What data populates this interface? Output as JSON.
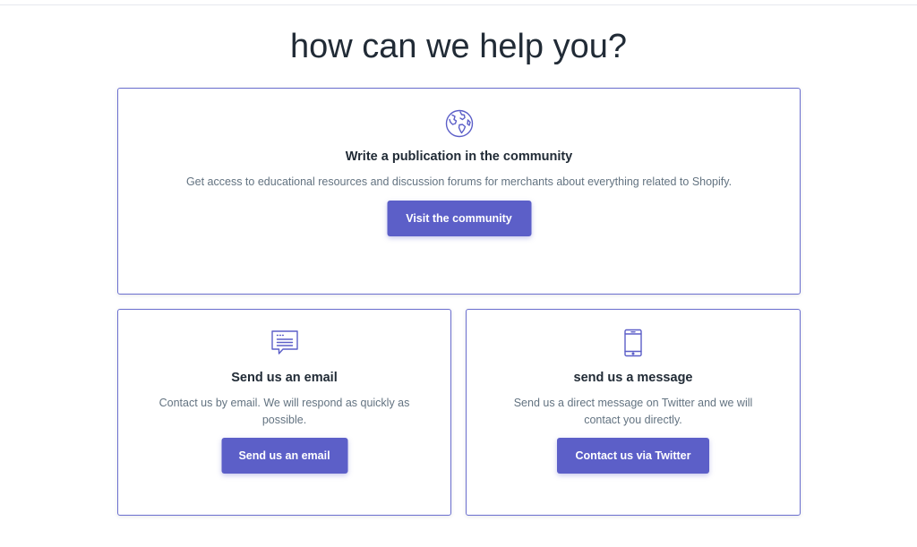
{
  "page": {
    "title": "how can we help you?"
  },
  "theme": {
    "accent": "#5c5fc8",
    "border": "#6b6fcf",
    "text_primary": "#212b36",
    "text_secondary": "#637381"
  },
  "cards": [
    {
      "icon": "globe-icon",
      "title": "Write a publication in the community",
      "description": "Get access to educational resources and discussion forums for merchants about everything related to Shopify.",
      "button_label": "Visit the community"
    },
    {
      "icon": "chat-bubble-icon",
      "title": "Send us an email",
      "description": "Contact us by email. We will respond as quickly as possible.",
      "button_label": "Send us an email"
    },
    {
      "icon": "mobile-phone-icon",
      "title": "send us a message",
      "description": "Send us a direct message on Twitter and we will contact you directly.",
      "button_label": "Contact us via Twitter"
    }
  ]
}
